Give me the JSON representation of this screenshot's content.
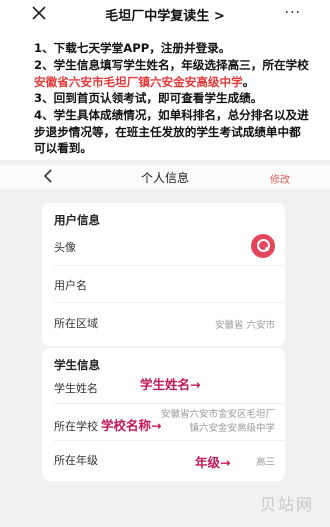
{
  "topbar": {
    "title": "毛坦厂中学复读生",
    "title_chevron": ">",
    "more": "···"
  },
  "article": {
    "p1": "1、下载七天学堂APP，注册并登录。",
    "p2_a": "2、学生信息填写学生姓名，年级选择高三，所在学校",
    "p2_red": "安徽省六安市毛坦厂镇六安金安高级中学",
    "p2_b": "。",
    "p3": "3、回到首页认领考试，即可查看学生成绩。",
    "p4": "4、学生具体成绩情况，如单科排名，总分排名以及进步退步情况等，在班主任发放的学生考试成绩单中都可以看到。"
  },
  "profile_header": {
    "title": "个人信息",
    "edit": "修改"
  },
  "user_info": {
    "title": "用户信息",
    "avatar_label": "头像",
    "username_label": "用户名",
    "region_label": "所在区域",
    "region_value": "安徽省 六安市"
  },
  "student_info": {
    "title": "学生信息",
    "name_label": "学生姓名",
    "school_label": "所在学校",
    "school_value": "安徽省六安市金安区毛坦厂镇六安金安高级中学",
    "grade_label": "所在年级",
    "grade_value": "高三"
  },
  "annotations": {
    "name": "学生姓名→",
    "school": "学校名称→",
    "grade": "年级→"
  },
  "watermark": "贝站网",
  "colors": {
    "accent_red": "#e23b3b",
    "annotation": "#c2185b",
    "avatar": "#e4475b"
  }
}
